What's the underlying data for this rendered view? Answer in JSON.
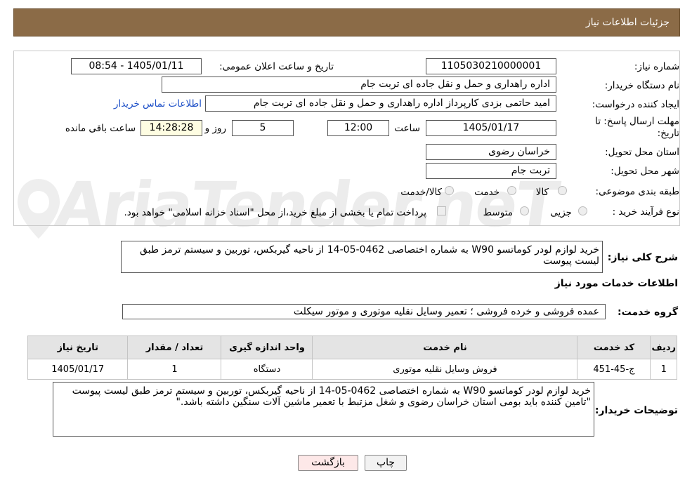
{
  "header": {
    "title": "جزئیات اطلاعات نیاز"
  },
  "form": {
    "need_number_label": "شماره نیاز:",
    "need_number": "1105030210000001",
    "announce_label": "تاریخ و ساعت اعلان عمومی:",
    "announce_value": "1405/01/11 - 08:54",
    "buyer_org_label": "نام دستگاه خریدار:",
    "buyer_org": "اداره راهداری و حمل و نقل جاده ای تربت جام",
    "creator_label": "ایجاد کننده درخواست:",
    "creator": "امید حاتمی بزدی کارپرداز اداره راهداری و حمل و نقل جاده ای تربت جام",
    "contact_link": "اطلاعات تماس خریدار",
    "deadline_label": "مهلت ارسال پاسخ: تا تاریخ:",
    "deadline_date": "1405/01/17",
    "time_label": "ساعت",
    "deadline_time": "12:00",
    "days_value": "5",
    "days_label": "روز و",
    "remaining_time": "14:28:28",
    "remaining_label": "ساعت باقی مانده",
    "province_label": "استان محل تحویل:",
    "province": "خراسان رضوی",
    "city_label": "شهر محل تحویل:",
    "city": "تربت جام",
    "category_label": "طبقه بندی موضوعی:",
    "category_options": [
      "کالا",
      "خدمت",
      "کالا/خدمت"
    ],
    "process_label": "نوع فرآیند خرید :",
    "process_options": [
      "جزیی",
      "متوسط"
    ],
    "payment_note": "پرداخت تمام یا بخشی از مبلغ خرید،از محل \"اسناد خزانه اسلامی\" خواهد بود."
  },
  "summary": {
    "label": "شرح کلی نیاز:",
    "text": "خرید لوازم لودر کوماتسو W90 به شماره اختصاصی 0462-05-14 از ناحیه گیربکس، توربین و سیستم ترمز طبق لیست پیوست"
  },
  "services": {
    "section_title": "اطلاعات خدمات مورد نیاز",
    "group_label": "گروه خدمت:",
    "group_value": "عمده فروشی و خرده فروشی ؛ تعمیر وسایل نقلیه موتوری و موتور سیکلت",
    "columns": [
      "ردیف",
      "کد خدمت",
      "نام خدمت",
      "واحد اندازه گیری",
      "تعداد / مقدار",
      "تاریخ نیاز"
    ],
    "rows": [
      [
        "1",
        "ج-45-451",
        "فروش وسایل نقلیه موتوری",
        "دستگاه",
        "1",
        "1405/01/17"
      ]
    ]
  },
  "buyer_notes": {
    "label": "توضیحات خریدار:",
    "line1": "خرید لوازم لودر کوماتسو W90 به شماره اختصاصی 0462-05-14 از ناحیه گیربکس، توربین و سیستم ترمز طبق لیست پیوست",
    "line2": "\"تامین کننده باید بومی استان خراسان رضوی و شغل مزتبط با تعمیر ماشین آلات سنگین داشته باشد.\""
  },
  "buttons": {
    "print": "چاپ",
    "back": "بازگشت"
  },
  "watermark": "AriaTender.neT",
  "colors": {
    "header_bg": "#8b6b47",
    "highlight_field": "#fefde2",
    "back_button": "#fde8e8",
    "link": "#1e50c8"
  }
}
